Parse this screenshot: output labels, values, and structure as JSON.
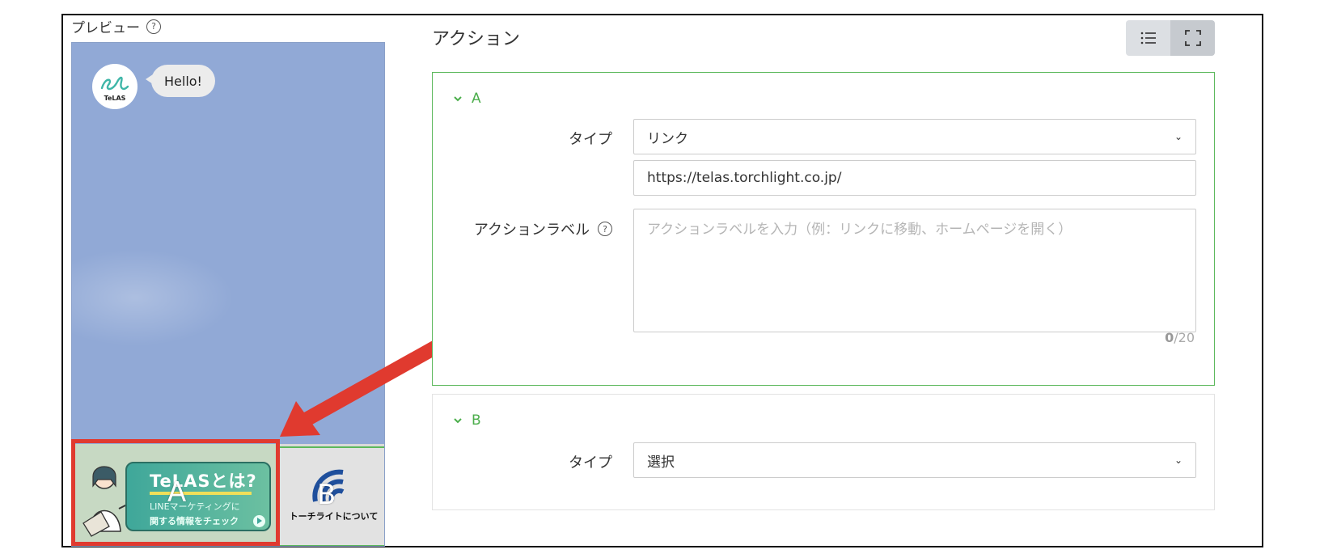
{
  "preview": {
    "title": "プレビュー",
    "help_glyph": "?",
    "avatar_text": "TeLAS",
    "message": "Hello!",
    "rich_menu": {
      "cell_a": {
        "label": "A",
        "banner_title": "TeLASとは?",
        "banner_line1": "LINEマーケティングに",
        "banner_line2": "関する情報をチェック"
      },
      "cell_b": {
        "label": "B",
        "caption": "トーチライトについて"
      }
    }
  },
  "action": {
    "title": "アクション",
    "view_toggle": [
      "list-icon",
      "fullscreen-icon"
    ],
    "sections": [
      {
        "name": "A",
        "type_label": "タイプ",
        "type_value": "リンク",
        "url_value": "https://telas.torchlight.co.jp/",
        "action_label_label": "アクションラベル",
        "action_label_placeholder": "アクションラベルを入力（例：リンクに移動、ホームページを開く）",
        "counter_current": "0",
        "counter_max": "/20"
      },
      {
        "name": "B",
        "type_label": "タイプ",
        "type_value": "選択"
      }
    ]
  },
  "colors": {
    "accent_green": "#5cb85c",
    "highlight_red": "#e03a2f",
    "chat_background": "#91a9d6"
  }
}
